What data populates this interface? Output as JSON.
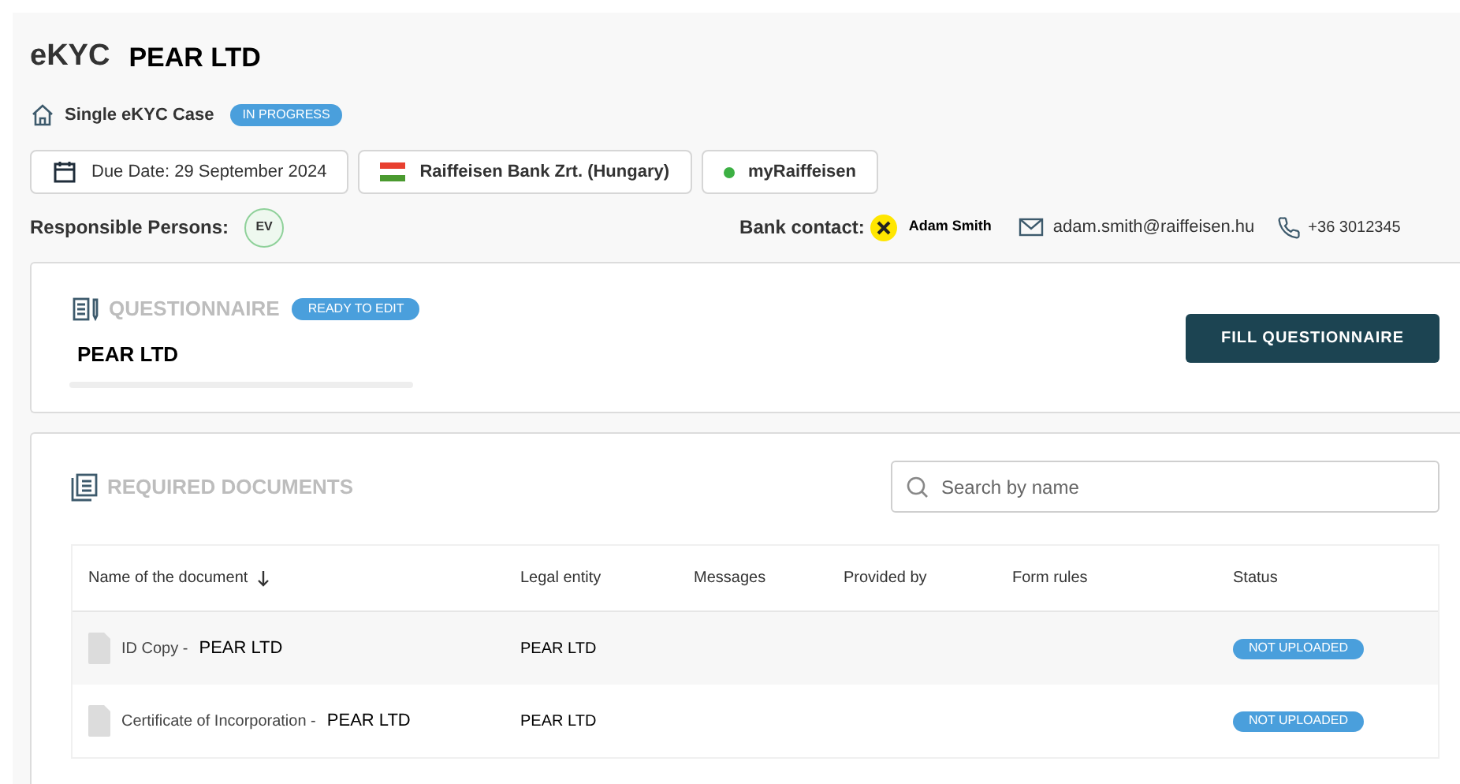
{
  "header": {
    "title": "eKYC",
    "company": "PEAR LTD",
    "case_type": "Single eKYC Case",
    "case_status": "IN PROGRESS"
  },
  "chips": [
    {
      "kind": "date",
      "label": "Due Date: 29 September 2024"
    },
    {
      "kind": "flag",
      "label": "Raiffeisen Bank Zrt. (Hungary)"
    },
    {
      "kind": "dot",
      "label": "myRaiffeisen",
      "color": "#3cb043"
    }
  ],
  "responsible": {
    "label": "Responsible Persons:",
    "initials": "EV"
  },
  "bank_contact": {
    "label": "Bank contact:",
    "name": "Adam Smith",
    "email": "adam.smith@raiffeisen.hu",
    "phone": "+36 3012345"
  },
  "questionnaire": {
    "title": "QUESTIONNAIRE",
    "status": "READY TO EDIT",
    "entity": "PEAR LTD",
    "button": "FILL QUESTIONNAIRE"
  },
  "documents": {
    "title": "REQUIRED DOCUMENTS",
    "search": {
      "placeholder": "Search by name"
    },
    "columns": [
      "Name of the document",
      "Legal entity",
      "Messages",
      "Provided by",
      "Form rules",
      "Status"
    ],
    "rows": [
      {
        "name": "ID Copy -",
        "entity_part": "PEAR LTD",
        "legal_entity": "PEAR LTD",
        "status": "NOT UPLOADED"
      },
      {
        "name": "Certificate of Incorporation -",
        "entity_part": "PEAR LTD",
        "legal_entity": "PEAR LTD",
        "status": "NOT UPLOADED"
      }
    ]
  }
}
